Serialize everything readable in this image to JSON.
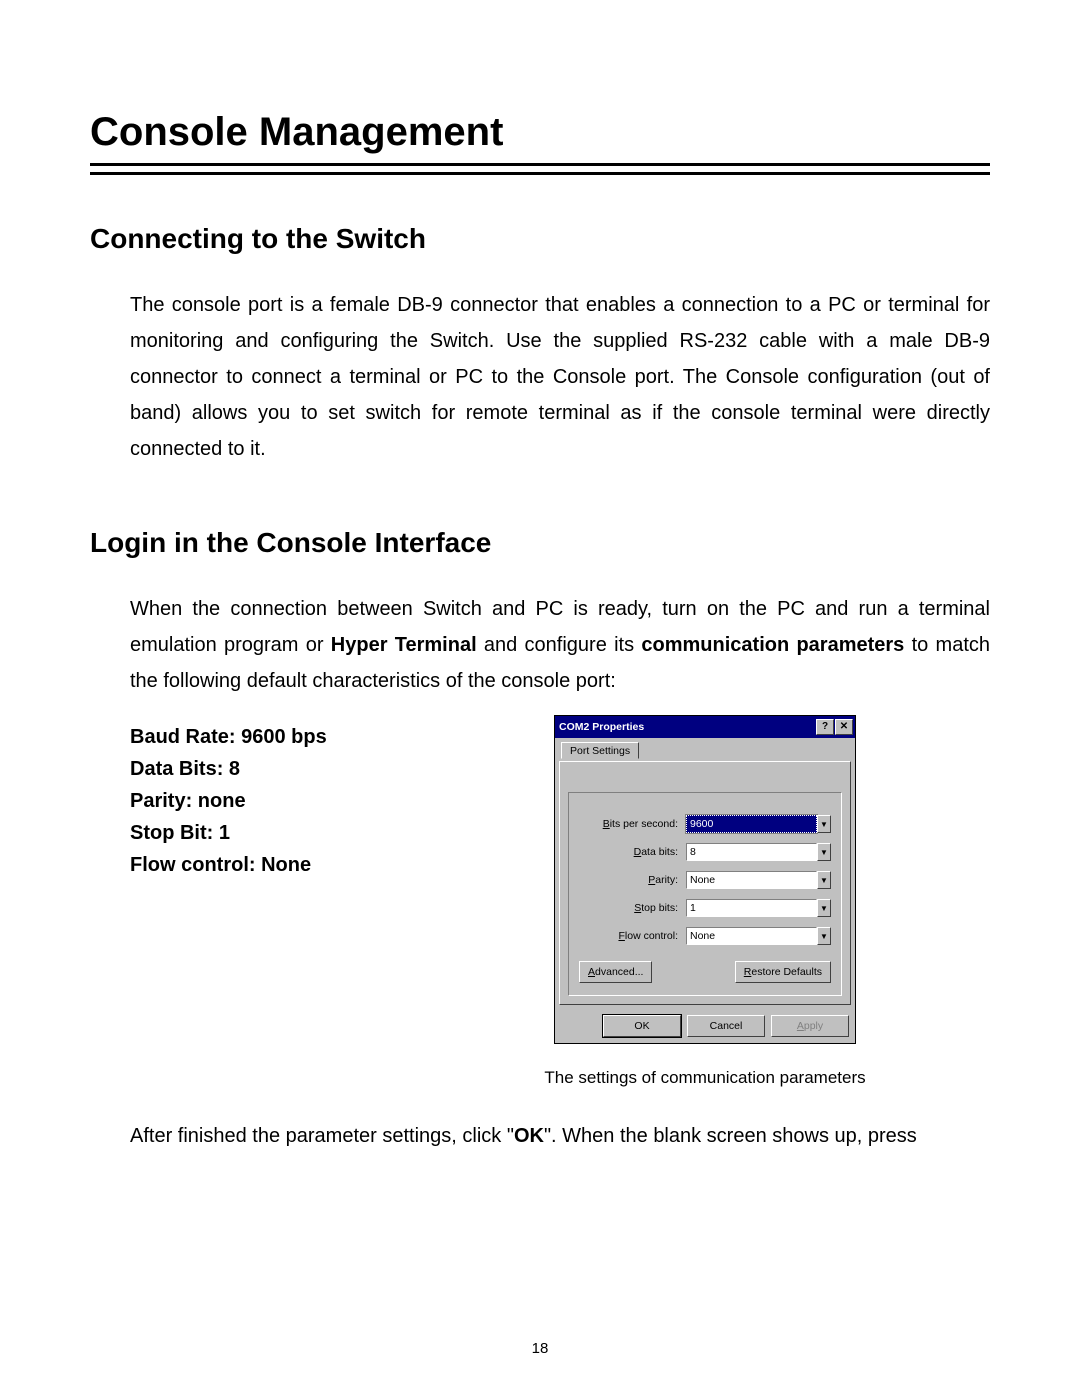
{
  "title": "Console Management",
  "section1": {
    "heading": "Connecting to the Switch",
    "para": "The console port is a female DB-9 connector that enables a connection to a PC or terminal for monitoring and configuring the Switch. Use the supplied RS-232 cable with a male DB-9 connector to connect a terminal or PC to the Console port. The Console configuration (out of band) allows you to set switch for remote terminal as if the console terminal were directly connected to it."
  },
  "section2": {
    "heading": "Login in the Console Interface",
    "para_before_bold1": "When the connection between Switch and PC is ready, turn on the PC and run a terminal emulation program or ",
    "bold1": "Hyper Terminal",
    "para_mid": " and configure its ",
    "bold2": "communication parameters",
    "para_after_bold2": " to match the following default characteristics of the console port:"
  },
  "specs": [
    "Baud Rate: 9600 bps",
    "Data Bits: 8",
    "Parity: none",
    "Stop Bit: 1",
    "Flow control: None"
  ],
  "dialog": {
    "title": "COM2 Properties",
    "help_glyph": "?",
    "close_glyph": "✕",
    "tab": "Port Settings",
    "fields": {
      "bits_per_second": {
        "label_pre": "B",
        "label_rest": "its per second:",
        "value": "9600"
      },
      "data_bits": {
        "label_pre": "D",
        "label_rest": "ata bits:",
        "value": "8"
      },
      "parity": {
        "label_pre": "P",
        "label_rest": "arity:",
        "value": "None"
      },
      "stop_bits": {
        "label_pre": "S",
        "label_rest": "top bits:",
        "value": "1"
      },
      "flow_control": {
        "label_pre": "F",
        "label_rest": "low control:",
        "value": "None"
      }
    },
    "buttons": {
      "advanced_pre": "A",
      "advanced_rest": "dvanced...",
      "restore_pre": "R",
      "restore_rest": "estore Defaults",
      "ok": "OK",
      "cancel": "Cancel",
      "apply_pre": "A",
      "apply_rest": "pply"
    },
    "dropdown_glyph": "▼"
  },
  "caption": "The settings of communication parameters",
  "after": {
    "pre": "After finished the parameter settings, click \"",
    "bold": "OK",
    "post": "\". When the blank screen shows up, press"
  },
  "page_number": "18"
}
